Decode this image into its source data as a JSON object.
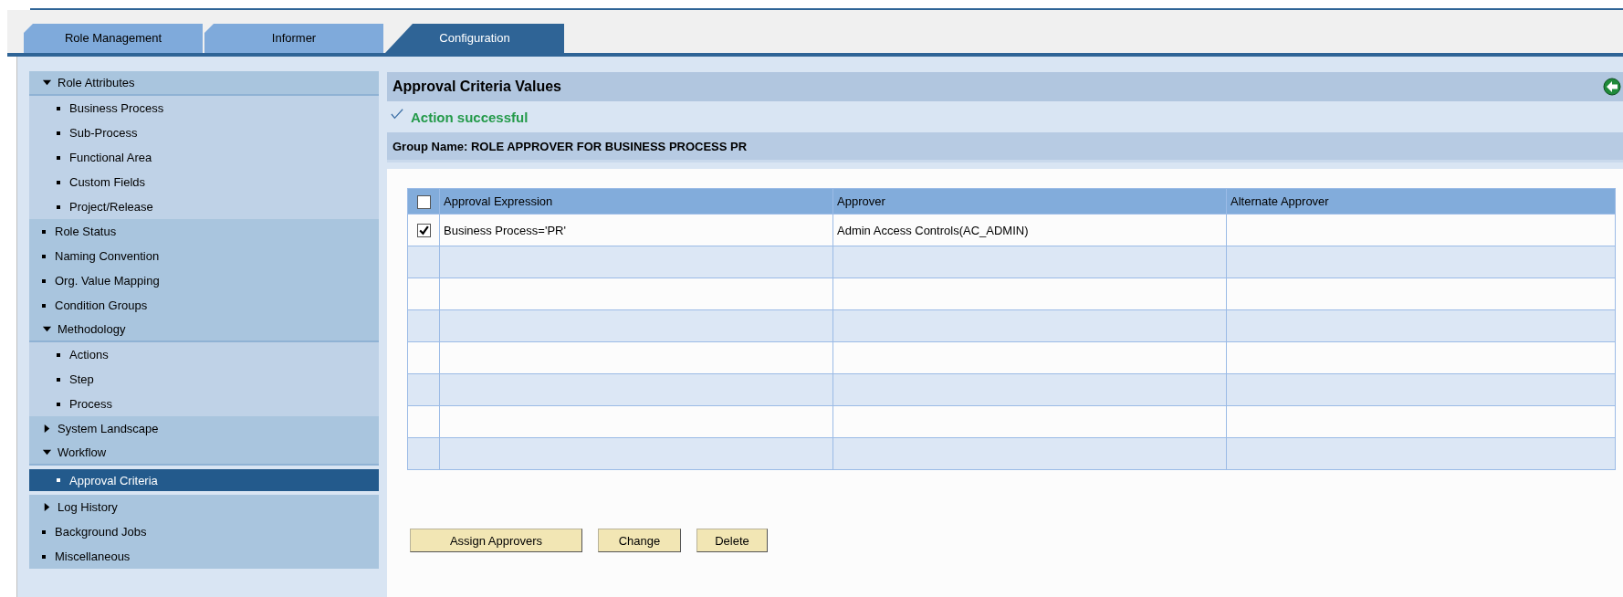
{
  "tabs": [
    {
      "label": "Role Management",
      "selected": false
    },
    {
      "label": "Informer",
      "selected": false
    },
    {
      "label": "Configuration",
      "selected": true
    }
  ],
  "sidebar": {
    "items": [
      {
        "label": "Role Attributes",
        "kind": "folder",
        "expanded": true,
        "selected": false,
        "children": [
          {
            "label": "Business Process",
            "kind": "leaf",
            "selected": false
          },
          {
            "label": "Sub-Process",
            "kind": "leaf",
            "selected": false
          },
          {
            "label": "Functional Area",
            "kind": "leaf",
            "selected": false
          },
          {
            "label": "Custom Fields",
            "kind": "leaf",
            "selected": false
          },
          {
            "label": "Project/Release",
            "kind": "leaf",
            "selected": false
          }
        ]
      },
      {
        "label": "Role Status",
        "kind": "leaf",
        "selected": false
      },
      {
        "label": "Naming Convention",
        "kind": "leaf",
        "selected": false
      },
      {
        "label": "Org. Value Mapping",
        "kind": "leaf",
        "selected": false
      },
      {
        "label": "Condition Groups",
        "kind": "leaf",
        "selected": false
      },
      {
        "label": "Methodology",
        "kind": "folder",
        "expanded": true,
        "selected": false,
        "children": [
          {
            "label": "Actions",
            "kind": "leaf",
            "selected": false
          },
          {
            "label": "Step",
            "kind": "leaf",
            "selected": false
          },
          {
            "label": "Process",
            "kind": "leaf",
            "selected": false
          }
        ]
      },
      {
        "label": "System Landscape",
        "kind": "folder",
        "expanded": false,
        "selected": false
      },
      {
        "label": "Workflow",
        "kind": "folder",
        "expanded": true,
        "selected": false,
        "children": [
          {
            "label": "Approval Criteria",
            "kind": "leaf",
            "selected": true
          }
        ]
      },
      {
        "label": "Log History",
        "kind": "folder",
        "expanded": false,
        "selected": false
      },
      {
        "label": "Background Jobs",
        "kind": "leaf",
        "selected": false
      },
      {
        "label": "Miscellaneous",
        "kind": "leaf",
        "selected": false
      }
    ]
  },
  "content": {
    "title": "Approval Criteria Values",
    "message": "Action successful",
    "group_name": "Group Name: ROLE APPROVER FOR BUSINESS PROCESS PR",
    "table": {
      "select_all_checked": false,
      "columns": [
        "Approval Expression",
        "Approver",
        "Alternate Approver"
      ],
      "rows": [
        {
          "checked": true,
          "approval_expression": "Business Process='PR'",
          "approver": "Admin Access Controls(AC_ADMIN)"
        }
      ]
    },
    "buttons": [
      "Assign Approvers",
      "Change",
      "Delete"
    ]
  }
}
